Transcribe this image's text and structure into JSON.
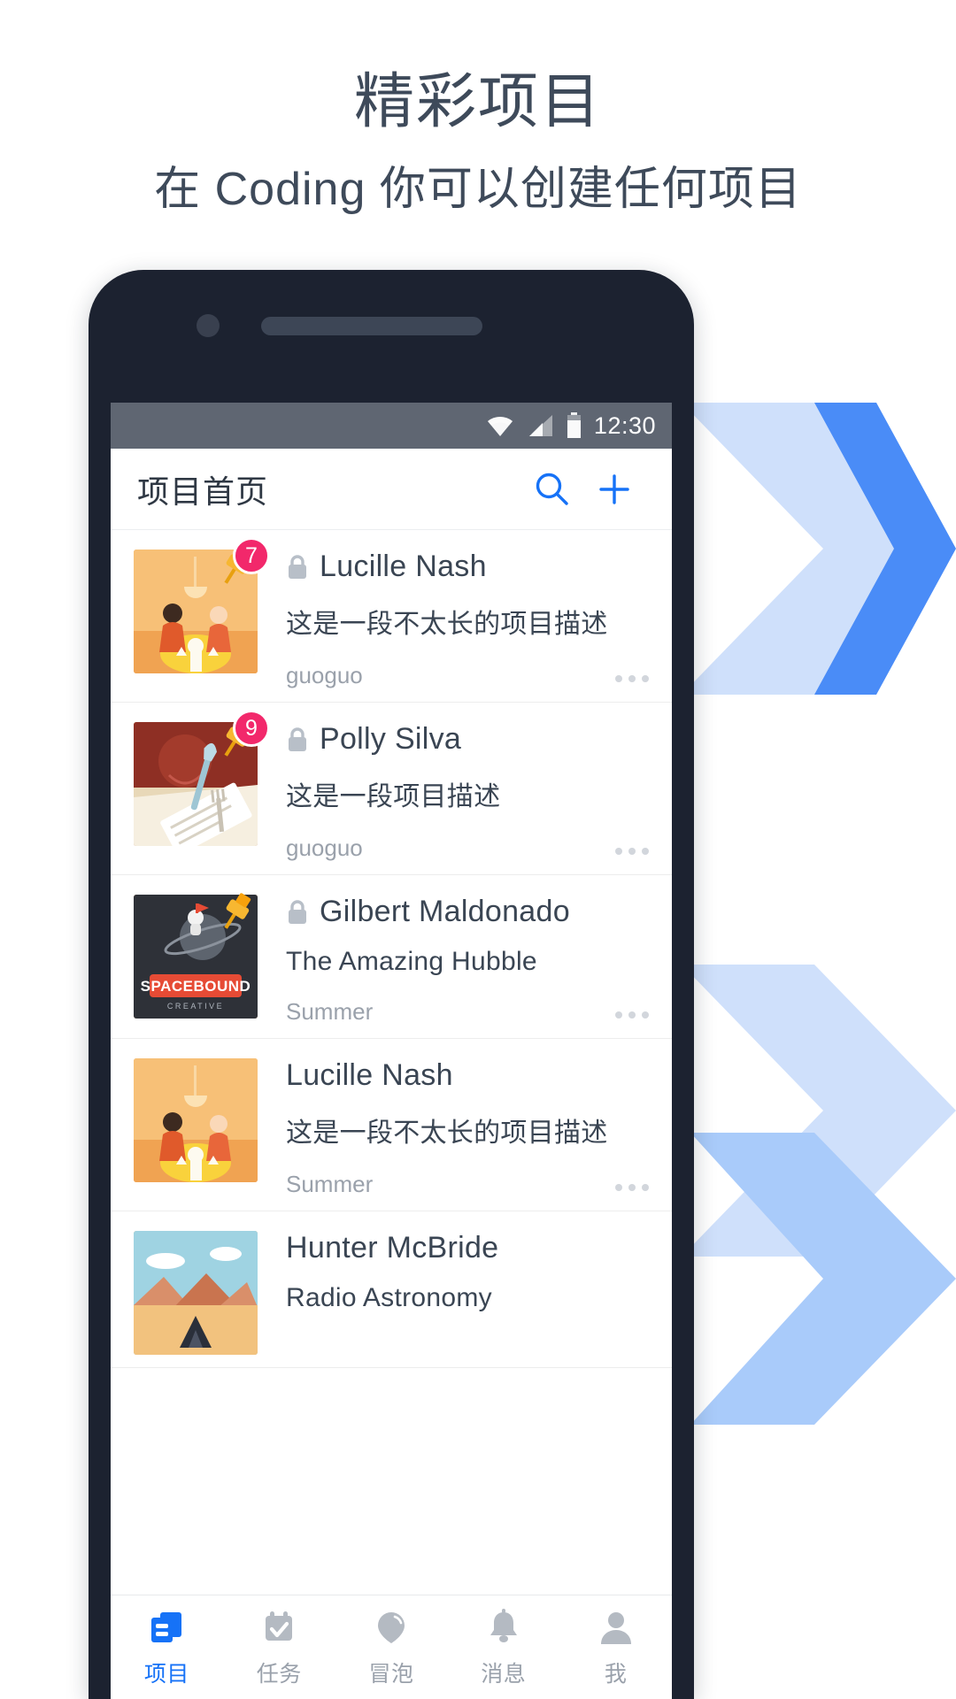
{
  "hero": {
    "title": "精彩项目",
    "subtitle": "在 Coding 你可以创建任何项目"
  },
  "colors": {
    "headline": "#3e4a5a",
    "accent_blue": "#1672f7",
    "badge_pink": "#f2286b",
    "statusbar": "#5f6672",
    "phone_body": "#1c2230",
    "chevron_light": "#cfe0fb",
    "chevron_dark": "#4a8cf7"
  },
  "statusbar": {
    "time": "12:30",
    "icons": [
      "wifi-icon",
      "signal-icon",
      "battery-icon"
    ]
  },
  "appbar": {
    "title": "项目首页",
    "search_icon": "search-icon",
    "add_icon": "plus-icon"
  },
  "projects": [
    {
      "name": "Lucille Nash",
      "description": "这是一段不太长的项目描述",
      "owner": "guoguo",
      "badge": "7",
      "private": true,
      "pinned": true,
      "thumb": "dinner-table"
    },
    {
      "name": "Polly Silva",
      "description": "这是一段项目描述",
      "owner": "guoguo",
      "badge": "9",
      "private": true,
      "pinned": true,
      "thumb": "paper-fork"
    },
    {
      "name": "Gilbert Maldonado",
      "description": "The Amazing Hubble",
      "owner": "Summer",
      "badge": "",
      "private": true,
      "pinned": true,
      "thumb": "spacebound"
    },
    {
      "name": "Lucille Nash",
      "description": "这是一段不太长的项目描述",
      "owner": "Summer",
      "badge": "",
      "private": false,
      "pinned": false,
      "thumb": "dinner-table"
    },
    {
      "name": "Hunter McBride",
      "description": "Radio Astronomy",
      "owner": "",
      "badge": "",
      "private": false,
      "pinned": false,
      "thumb": "mountain-camp"
    }
  ],
  "bottom_nav": [
    {
      "label": "项目",
      "icon": "projects-icon",
      "active": true
    },
    {
      "label": "任务",
      "icon": "tasks-calendar-icon",
      "active": false
    },
    {
      "label": "冒泡",
      "icon": "bubble-icon",
      "active": false
    },
    {
      "label": "消息",
      "icon": "bell-icon",
      "active": false
    },
    {
      "label": "我",
      "icon": "person-icon",
      "active": false
    }
  ]
}
